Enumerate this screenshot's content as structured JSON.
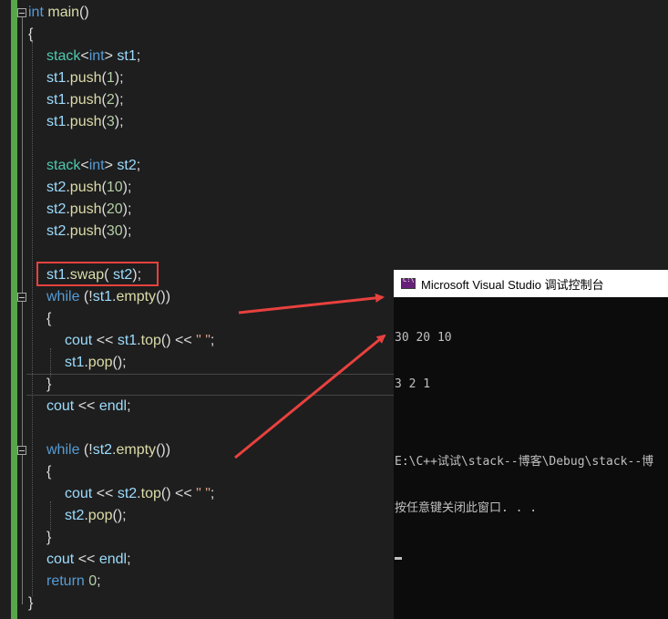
{
  "code": {
    "lines": [
      [
        [
          "int",
          "kw"
        ],
        [
          " ",
          "plain"
        ],
        [
          "main",
          "fn"
        ],
        [
          "()",
          "plain"
        ]
      ],
      [
        [
          "{",
          "plain"
        ]
      ],
      [
        [
          "stack",
          "type"
        ],
        [
          "<",
          "plain"
        ],
        [
          "int",
          "kw"
        ],
        [
          "> ",
          "plain"
        ],
        [
          "st1",
          "var"
        ],
        [
          ";",
          "plain"
        ]
      ],
      [
        [
          "st1",
          "var"
        ],
        [
          ".",
          "plain"
        ],
        [
          "push",
          "fn"
        ],
        [
          "(",
          "plain"
        ],
        [
          "1",
          "num"
        ],
        [
          ");",
          "plain"
        ]
      ],
      [
        [
          "st1",
          "var"
        ],
        [
          ".",
          "plain"
        ],
        [
          "push",
          "fn"
        ],
        [
          "(",
          "plain"
        ],
        [
          "2",
          "num"
        ],
        [
          ");",
          "plain"
        ]
      ],
      [
        [
          "st1",
          "var"
        ],
        [
          ".",
          "plain"
        ],
        [
          "push",
          "fn"
        ],
        [
          "(",
          "plain"
        ],
        [
          "3",
          "num"
        ],
        [
          ");",
          "plain"
        ]
      ],
      [],
      [
        [
          "stack",
          "type"
        ],
        [
          "<",
          "plain"
        ],
        [
          "int",
          "kw"
        ],
        [
          "> ",
          "plain"
        ],
        [
          "st2",
          "var"
        ],
        [
          ";",
          "plain"
        ]
      ],
      [
        [
          "st2",
          "var"
        ],
        [
          ".",
          "plain"
        ],
        [
          "push",
          "fn"
        ],
        [
          "(",
          "plain"
        ],
        [
          "10",
          "num"
        ],
        [
          ");",
          "plain"
        ]
      ],
      [
        [
          "st2",
          "var"
        ],
        [
          ".",
          "plain"
        ],
        [
          "push",
          "fn"
        ],
        [
          "(",
          "plain"
        ],
        [
          "20",
          "num"
        ],
        [
          ");",
          "plain"
        ]
      ],
      [
        [
          "st2",
          "var"
        ],
        [
          ".",
          "plain"
        ],
        [
          "push",
          "fn"
        ],
        [
          "(",
          "plain"
        ],
        [
          "30",
          "num"
        ],
        [
          ");",
          "plain"
        ]
      ],
      [],
      [
        [
          "st1",
          "var"
        ],
        [
          ".",
          "plain"
        ],
        [
          "swap",
          "fn"
        ],
        [
          "( ",
          "plain"
        ],
        [
          "st2",
          "var"
        ],
        [
          ");",
          "plain"
        ]
      ],
      [
        [
          "while",
          "kw"
        ],
        [
          " (!",
          "plain"
        ],
        [
          "st1",
          "var"
        ],
        [
          ".",
          "plain"
        ],
        [
          "empty",
          "fn"
        ],
        [
          "())",
          "plain"
        ]
      ],
      [
        [
          "{",
          "plain"
        ]
      ],
      [
        [
          "cout",
          "var"
        ],
        [
          " << ",
          "plain"
        ],
        [
          "st1",
          "var"
        ],
        [
          ".",
          "plain"
        ],
        [
          "top",
          "fn"
        ],
        [
          "() << ",
          "plain"
        ],
        [
          "\" \"",
          "str"
        ],
        [
          ";",
          "plain"
        ]
      ],
      [
        [
          "st1",
          "var"
        ],
        [
          ".",
          "plain"
        ],
        [
          "pop",
          "fn"
        ],
        [
          "();",
          "plain"
        ]
      ],
      [
        [
          "}",
          "plain"
        ]
      ],
      [
        [
          "cout",
          "var"
        ],
        [
          " << ",
          "plain"
        ],
        [
          "endl",
          "var"
        ],
        [
          ";",
          "plain"
        ]
      ],
      [],
      [
        [
          "while",
          "kw"
        ],
        [
          " (!",
          "plain"
        ],
        [
          "st2",
          "var"
        ],
        [
          ".",
          "plain"
        ],
        [
          "empty",
          "fn"
        ],
        [
          "())",
          "plain"
        ]
      ],
      [
        [
          "{",
          "plain"
        ]
      ],
      [
        [
          "cout",
          "var"
        ],
        [
          " << ",
          "plain"
        ],
        [
          "st2",
          "var"
        ],
        [
          ".",
          "plain"
        ],
        [
          "top",
          "fn"
        ],
        [
          "() << ",
          "plain"
        ],
        [
          "\" \"",
          "str"
        ],
        [
          ";",
          "plain"
        ]
      ],
      [
        [
          "st2",
          "var"
        ],
        [
          ".",
          "plain"
        ],
        [
          "pop",
          "fn"
        ],
        [
          "();",
          "plain"
        ]
      ],
      [
        [
          "}",
          "plain"
        ]
      ],
      [
        [
          "cout",
          "var"
        ],
        [
          " << ",
          "plain"
        ],
        [
          "endl",
          "var"
        ],
        [
          ";",
          "plain"
        ]
      ],
      [
        [
          "return",
          "kw"
        ],
        [
          " ",
          "plain"
        ],
        [
          "0",
          "num"
        ],
        [
          ";",
          "plain"
        ]
      ],
      [
        [
          "}",
          "plain"
        ]
      ]
    ]
  },
  "console": {
    "title": "Microsoft Visual Studio 调试控制台",
    "icon": "console-app-icon",
    "output_lines": [
      "30 20 10",
      "3 2 1",
      "",
      "E:\\C++试试\\stack--博客\\Debug\\stack--博",
      "按任意键关闭此窗口. . ."
    ]
  },
  "colors": {
    "editor_bg": "#1e1e1e",
    "keyword": "#569cd6",
    "type": "#4ec9b0",
    "variable": "#9cdcfe",
    "function": "#dcdcaa",
    "number": "#b5cea8",
    "string": "#d69d85",
    "annotation": "#e8413e",
    "change_bar": "#57a64a"
  }
}
